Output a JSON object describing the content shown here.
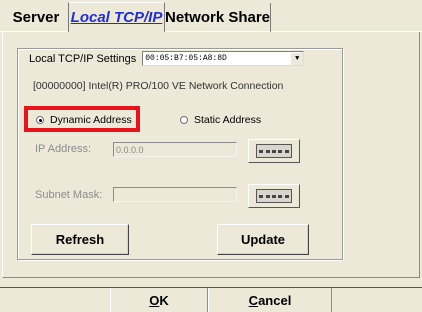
{
  "tabs": [
    {
      "label": "Server",
      "active": false
    },
    {
      "label": "Local TCP/IP",
      "active": true
    },
    {
      "label": "Network Share",
      "active": false
    }
  ],
  "group": {
    "label": "Local TCP/IP Settings",
    "selected_mac": "00:05:B7:05:A8:8D",
    "adapter": "[00000000] Intel(R) PRO/100 VE Network Connection"
  },
  "radios": {
    "dynamic": {
      "label": "Dynamic Address",
      "checked": true
    },
    "static": {
      "label": "Static Address",
      "checked": false
    }
  },
  "fields": {
    "ip_label": "IP Address:",
    "ip_value": "0.0.0.0",
    "subnet_label": "Subnet Mask:",
    "subnet_value": ""
  },
  "buttons": {
    "refresh": "Refresh",
    "update": "Update",
    "ok": {
      "accel": "O",
      "rest": "K"
    },
    "cancel": {
      "accel": "C",
      "rest": "ancel"
    }
  },
  "colors": {
    "highlight": "#e8141b",
    "active_tab_text": "#1e2fd6",
    "background": "#ece9d8"
  }
}
